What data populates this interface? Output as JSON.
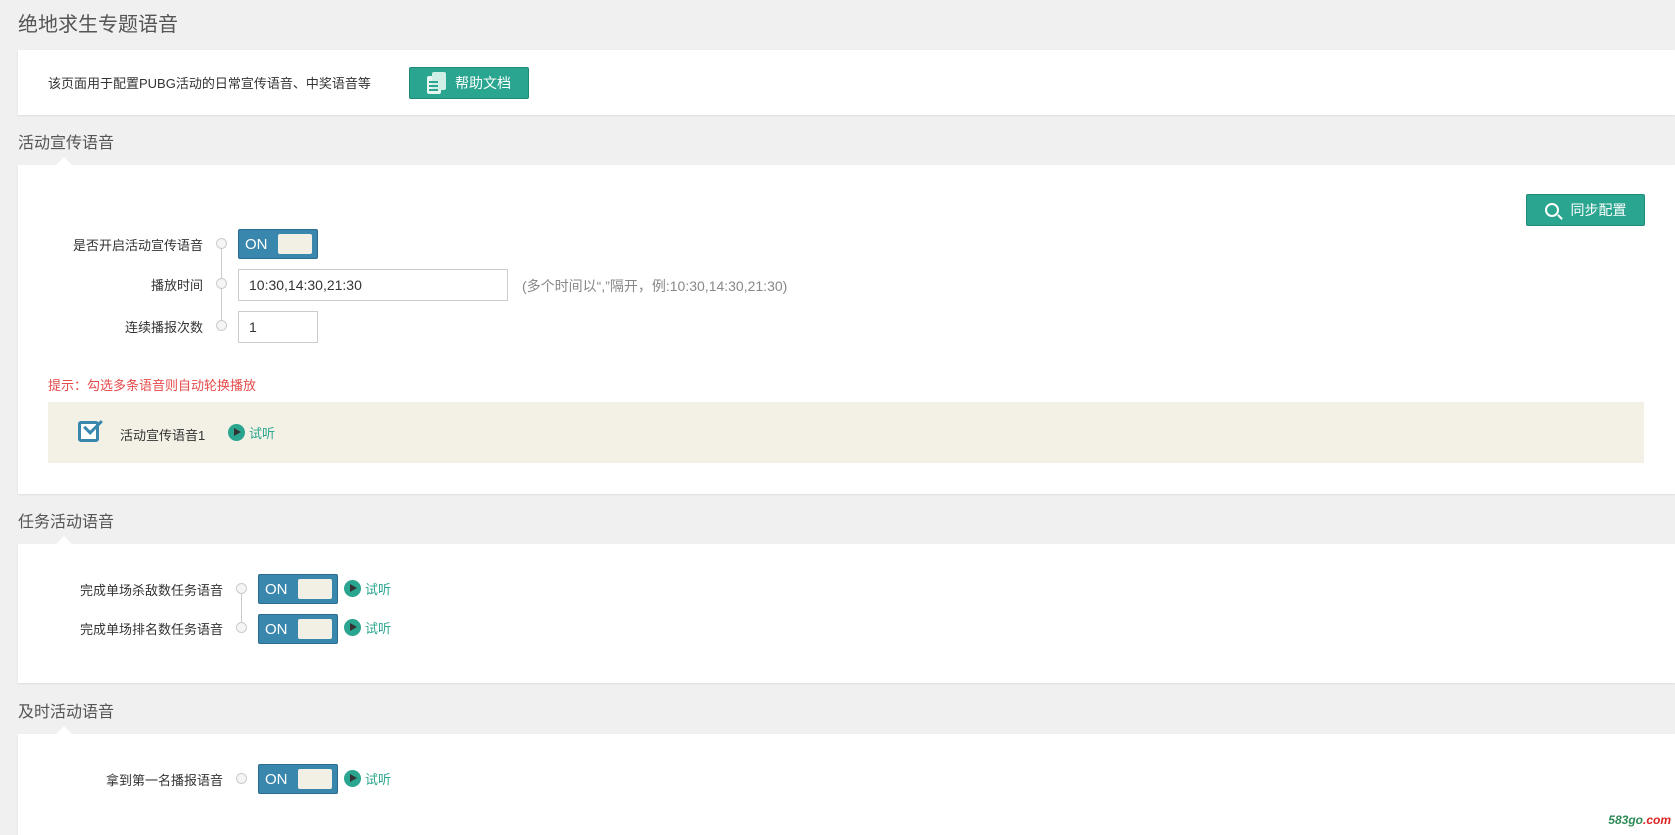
{
  "page": {
    "title": "绝地求生专题语音"
  },
  "intro": {
    "text": "该页面用于配置PUBG活动的日常宣传语音、中奖语音等",
    "help_button": "帮助文档"
  },
  "section_promo": {
    "title": "活动宣传语音",
    "sync_button": "同步配置",
    "fields": {
      "enable_label": "是否开启活动宣传语音",
      "enable_toggle": "ON",
      "time_label": "播放时间",
      "time_value": "10:30,14:30,21:30",
      "time_hint": "(多个时间以“,”隔开，例:10:30,14:30,21:30)",
      "count_label": "连续播报次数",
      "count_value": "1"
    },
    "tip": "提示：勾选多条语音则自动轮换播放",
    "voices": [
      {
        "label": "活动宣传语音1",
        "checked": true,
        "listen": "试听"
      }
    ]
  },
  "section_task": {
    "title": "任务活动语音",
    "items": [
      {
        "label": "完成单场杀敌数任务语音",
        "toggle": "ON",
        "listen": "试听"
      },
      {
        "label": "完成单场排名数任务语音",
        "toggle": "ON",
        "listen": "试听"
      }
    ]
  },
  "section_instant": {
    "title": "及时活动语音",
    "items": [
      {
        "label": "拿到第一名播报语音",
        "toggle": "ON",
        "listen": "试听"
      }
    ]
  },
  "watermark": {
    "green": "583go",
    "red": ".com"
  },
  "colors": {
    "accent_green": "#2aa58f",
    "toggle_blue": "#3a87ad",
    "warning_red": "#e64b4b",
    "voice_box_bg": "#f3f1e6",
    "page_bg": "#f0f0f0"
  }
}
